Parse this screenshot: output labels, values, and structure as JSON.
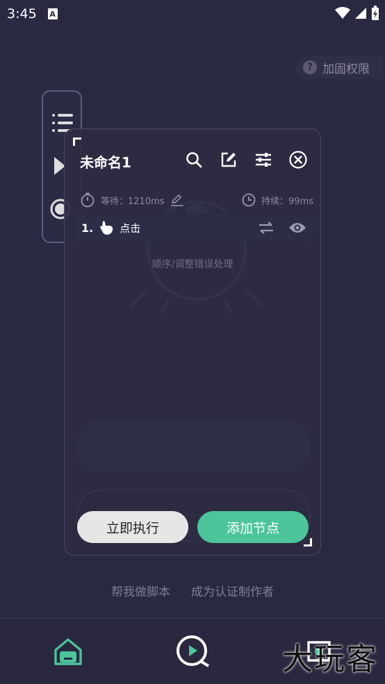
{
  "status": {
    "time": "3:45",
    "notif_letter": "A"
  },
  "permission": {
    "label": "加固权限",
    "icon": "question-icon"
  },
  "panel": {
    "title": "未命名1",
    "wait_label": "等待：1210ms",
    "duration_label": "持续：99ms",
    "node": {
      "number": "1.",
      "label": "点击"
    },
    "hint": "顺序/调整错误处理",
    "run_button": "立即执行",
    "add_button": "添加节点"
  },
  "links": {
    "help": "帮我做脚本",
    "become_author": "成为认证制作者"
  },
  "watermark": "大玩客",
  "colors": {
    "background": "#2a2942",
    "accent": "#4cc59a",
    "run_button_bg": "#e6e6e6"
  }
}
